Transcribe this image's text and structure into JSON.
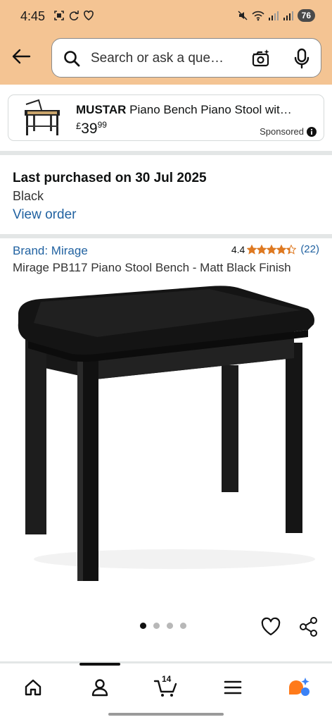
{
  "status_bar": {
    "time": "4:45",
    "battery": "76"
  },
  "search": {
    "placeholder": "Search or ask a que…"
  },
  "sponsored": {
    "brand": "MUSTAR",
    "title_rest": " Piano Bench Piano Stool wit…",
    "price_currency": "£",
    "price_whole": "39",
    "price_fraction": "99",
    "label": "Sponsored"
  },
  "purchase": {
    "title": "Last purchased on 30 Jul 2025",
    "variant": "Black",
    "view_order": "View order"
  },
  "product": {
    "brand_link": "Brand: Mirage",
    "rating_value": "4.4",
    "rating_stars": 4.4,
    "rating_count": "(22)",
    "title": "Mirage PB117 Piano Stool Bench - Matt Black Finish",
    "image_count": 4,
    "active_image": 1
  },
  "bottom_nav": {
    "cart_count": "14"
  },
  "colors": {
    "header": "#f4c493",
    "link": "#2162a1",
    "star": "#de7921"
  }
}
